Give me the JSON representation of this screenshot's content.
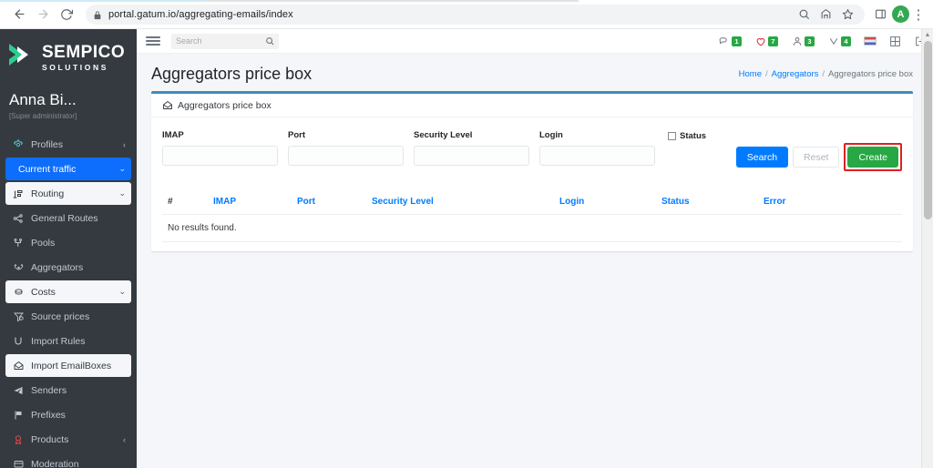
{
  "browser": {
    "back_icon": "back-arrow-icon",
    "forward_icon": "forward-arrow-icon",
    "reload_icon": "reload-icon",
    "lock_icon": "lock-icon",
    "url": "portal.gatum.io/aggregating-emails/index",
    "search_icon": "search-icon",
    "share_icon": "share-icon",
    "bookmark_icon": "star-icon",
    "sidepanel_icon": "side-panel-icon",
    "profile_initial": "A",
    "menu_icon": "kebab-menu-icon"
  },
  "sidebar": {
    "brand": {
      "title": "SEMPICO",
      "subtitle": "SOLUTIONS",
      "logo_icon": "sempico-chevron-logo"
    },
    "user": {
      "name": "Anna Bi...",
      "role": "[Super administrator]"
    },
    "items": [
      {
        "label": "Profiles",
        "icon": "gear-icon",
        "caret": "‹",
        "state": "default"
      },
      {
        "label": "Current traffic",
        "icon": "",
        "caret": "⌄",
        "state": "active-blue"
      },
      {
        "label": "Routing",
        "icon": "routing-icon",
        "caret": "⌄",
        "state": "active-light"
      },
      {
        "label": "General Routes",
        "icon": "share-nodes-icon",
        "caret": "",
        "state": "default"
      },
      {
        "label": "Pools",
        "icon": "sitemap-icon",
        "caret": "",
        "state": "default"
      },
      {
        "label": "Aggregators",
        "icon": "aggregators-icon",
        "caret": "",
        "state": "default"
      },
      {
        "label": "Costs",
        "icon": "coins-icon",
        "caret": "⌄",
        "state": "active-light"
      },
      {
        "label": "Source prices",
        "icon": "filter-dollar-icon",
        "caret": "",
        "state": "default"
      },
      {
        "label": "Import Rules",
        "icon": "import-rules-icon",
        "caret": "",
        "state": "default"
      },
      {
        "label": "Import EmailBoxes",
        "icon": "envelope-icon",
        "caret": "",
        "state": "active-light"
      },
      {
        "label": "Senders",
        "icon": "paper-plane-icon",
        "caret": "",
        "state": "default"
      },
      {
        "label": "Prefixes",
        "icon": "flag-icon",
        "caret": "",
        "state": "default"
      },
      {
        "label": "Products",
        "icon": "award-icon",
        "caret": "‹",
        "state": "default"
      },
      {
        "label": "Moderation",
        "icon": "moderation-icon",
        "caret": "",
        "state": "default"
      }
    ]
  },
  "topbar": {
    "menu_toggle_icon": "hamburger-icon",
    "search_placeholder": "Search",
    "search_value": "",
    "search_icon": "search-icon",
    "icons": [
      {
        "name": "comments-icon",
        "badge": "1"
      },
      {
        "name": "heart-alert-icon",
        "badge": "7"
      },
      {
        "name": "users-icon",
        "badge": "3"
      },
      {
        "name": "bell-check-icon",
        "badge": "4"
      }
    ],
    "flag_icon": "language-flag-icon",
    "grid_icon": "grid-icon",
    "logout_icon": "logout-icon"
  },
  "page": {
    "title": "Aggregators price box",
    "breadcrumb": [
      {
        "label": "Home",
        "link": true
      },
      {
        "label": "Aggregators",
        "link": true
      },
      {
        "label": "Aggregators price box",
        "link": false
      }
    ],
    "breadcrumb_separator": "/"
  },
  "card": {
    "header_icon": "envelope-open-icon",
    "header_title": "Aggregators price box",
    "filters": [
      {
        "label": "IMAP",
        "value": "",
        "placeholder": ""
      },
      {
        "label": "Port",
        "value": "",
        "placeholder": ""
      },
      {
        "label": "Security Level",
        "value": "",
        "placeholder": ""
      },
      {
        "label": "Login",
        "value": "",
        "placeholder": ""
      }
    ],
    "status_filter": {
      "label": "Status",
      "checked": false
    },
    "buttons": {
      "search": "Search",
      "reset": "Reset",
      "create": "Create"
    },
    "table": {
      "columns": [
        "#",
        "IMAP",
        "Port",
        "Security Level",
        "Login",
        "Status",
        "Error"
      ],
      "rows": [],
      "empty_message": "No results found."
    }
  },
  "colors": {
    "sidebar_bg": "#343a40",
    "accent_blue": "#007bff",
    "card_top_border": "#3c8dbc",
    "create_green": "#28a745",
    "highlight_red": "#e02020",
    "badge_green": "#28a745"
  },
  "scrollbar": {
    "up_arrow": "▲"
  }
}
